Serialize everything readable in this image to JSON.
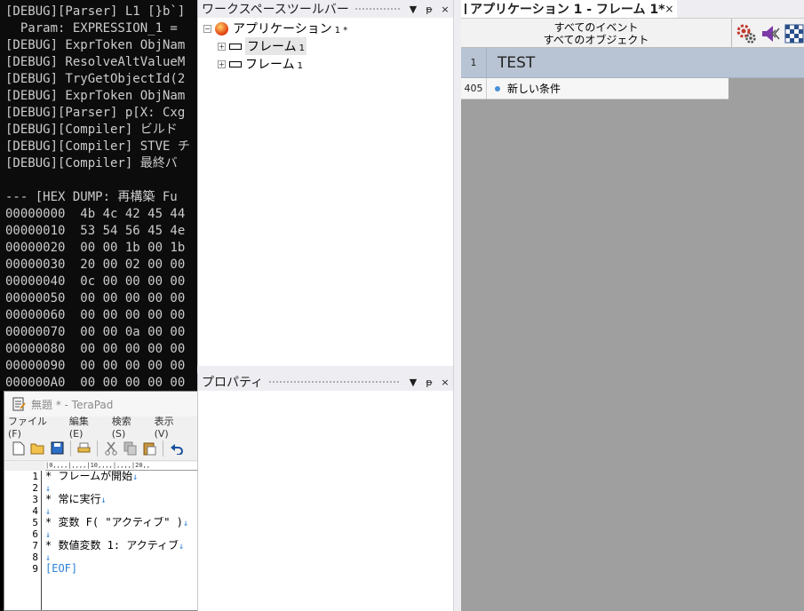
{
  "console": {
    "lines": [
      "[DEBUG][Parser] L1 [}b`] ",
      "  Param: EXPRESSION_1 = ",
      "[DEBUG] ExprToken ObjNam",
      "[DEBUG] ResolveAltValueM",
      "[DEBUG] TryGetObjectId(2",
      "[DEBUG] ExprToken ObjNam",
      "[DEBUG][Parser] p[X: Cxg",
      "[DEBUG][Compiler] ビルド",
      "[DEBUG][Compiler] STVE チ",
      "[DEBUG][Compiler] 最終バ",
      "",
      "--- [HEX DUMP: 再構築 Fu",
      "00000000  4b 4c 42 45 44",
      "00000010  53 54 56 45 4e",
      "00000020  00 00 1b 00 1b",
      "00000030  20 00 02 00 00",
      "00000040  0c 00 00 00 00",
      "00000050  00 00 00 00 00",
      "00000060  00 00 00 00 00",
      "00000070  00 00 0a 00 00",
      "00000080  00 00 00 00 00",
      "00000090  00 00 00 00 00",
      "000000A0  00 00 00 00 00"
    ]
  },
  "terapad": {
    "title": "無題 * - TeraPad",
    "menu": [
      "ファイル(F)",
      "編集(E)",
      "検索(S)",
      "表示(V)"
    ],
    "ruler": "|0,,,,|,,,,|10,,,,|,,,,|20,,",
    "line_numbers": [
      "1",
      "2",
      "3",
      "4",
      "5",
      "6",
      "7",
      "8",
      "9"
    ],
    "lines": [
      "* フレームが開始",
      "",
      "* 常に実行",
      "",
      "* 変数 F( \"アクティブ\" )",
      "",
      "* 数値変数 1: アクティブ",
      "",
      ""
    ],
    "return_mark": "↓",
    "eof": "[EOF]"
  },
  "workspace": {
    "title": "ワークスペースツールバー",
    "pin": "ᵽ",
    "close": "×",
    "dropdown": "▼",
    "tree": {
      "app_label": "アプリケーション",
      "app_suffix": "1 *",
      "frames": [
        {
          "label": "フレーム",
          "suffix": "1"
        },
        {
          "label": "フレーム",
          "suffix": "1"
        }
      ]
    }
  },
  "properties": {
    "title": "プロパティ"
  },
  "editor": {
    "tab_title": "アプリケーション 1 - フレーム 1*",
    "tab_close": "×",
    "header_line1": "すべてのイベント",
    "header_line2": "すべてのオブジェクト",
    "group_number": "1",
    "group_name": "TEST",
    "row_number": "405",
    "row_text": "新しい条件"
  }
}
